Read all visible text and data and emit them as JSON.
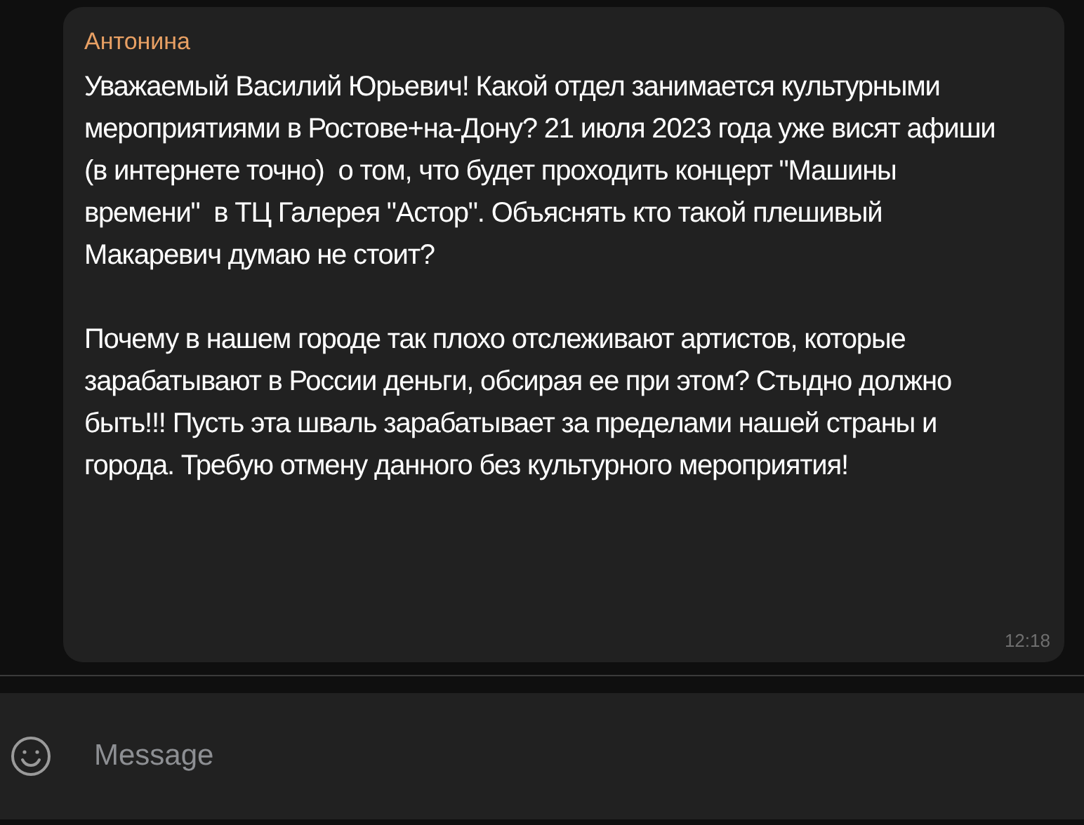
{
  "message": {
    "sender": "Антонина",
    "paragraphs": [
      "Уважаемый Василий Юрьевич! Какой отдел занимается культурными мероприятиями в Ростове+на-Дону? 21 июля 2023 года уже висят афиши (в интернете точно)  о том, что будет проходить концерт \"Машины времени\"  в ТЦ Галерея \"Астор\". Объяснять кто такой плешивый Макаревич думаю не стоит?",
      "Почему в нашем городе так плохо отслеживают артистов, которые зарабатывают в России деньги, обсирая ее при этом? Стыдно должно быть!!! Пусть эта шваль зарабатывает за пределами нашей страны и города. Требую отмену данного без культурного мероприятия!"
    ],
    "time": "12:18"
  },
  "composer": {
    "placeholder": "Message"
  }
}
